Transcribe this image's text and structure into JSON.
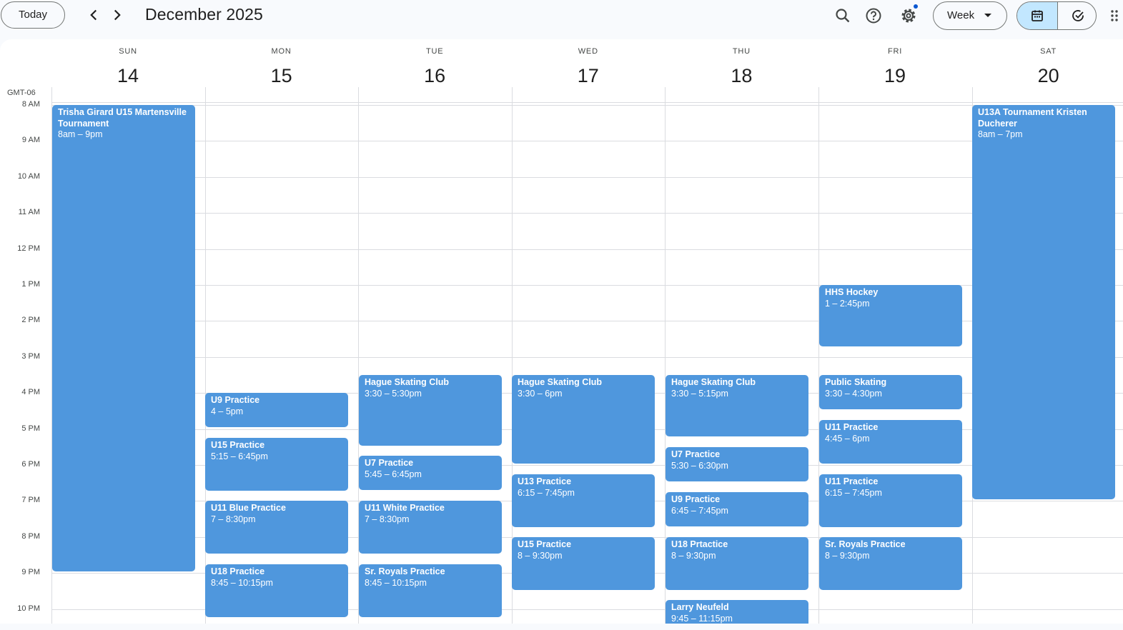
{
  "toolbar": {
    "today_label": "Today",
    "month_title": "December 2025",
    "view_label": "Week",
    "prev_icon": "chevron-left-icon",
    "next_icon": "chevron-right-icon",
    "search_icon": "search-icon",
    "help_icon": "help-icon",
    "settings_icon": "gear-icon",
    "calendar_view_icon": "calendar-icon",
    "tasks_view_icon": "task-check-icon",
    "apps_icon": "apps-grid-icon",
    "accent_color": "#c2e7ff"
  },
  "timezone": "GMT-06",
  "days": [
    {
      "name": "SUN",
      "num": "14"
    },
    {
      "name": "MON",
      "num": "15"
    },
    {
      "name": "TUE",
      "num": "16"
    },
    {
      "name": "WED",
      "num": "17"
    },
    {
      "name": "THU",
      "num": "18"
    },
    {
      "name": "FRI",
      "num": "19"
    },
    {
      "name": "SAT",
      "num": "20"
    }
  ],
  "hours": [
    "8 AM",
    "9 AM",
    "10 AM",
    "11 AM",
    "12 PM",
    "1 PM",
    "2 PM",
    "3 PM",
    "4 PM",
    "5 PM",
    "6 PM",
    "7 PM",
    "8 PM",
    "9 PM",
    "10 PM"
  ],
  "event_color": "#4f97dd",
  "events": [
    {
      "day": 0,
      "start": 8.0,
      "end": 21.0,
      "title": "Trisha Girard U15 Martensville Tournament",
      "time": "8am – 9pm"
    },
    {
      "day": 1,
      "start": 16.0,
      "end": 17.0,
      "title": "U9 Practice",
      "time": "4 – 5pm"
    },
    {
      "day": 1,
      "start": 17.25,
      "end": 18.75,
      "title": "U15 Practice",
      "time": "5:15 – 6:45pm"
    },
    {
      "day": 1,
      "start": 19.0,
      "end": 20.5,
      "title": "U11 Blue Practice",
      "time": "7 – 8:30pm"
    },
    {
      "day": 1,
      "start": 20.75,
      "end": 22.25,
      "title": "U18 Practice",
      "time": "8:45 – 10:15pm"
    },
    {
      "day": 2,
      "start": 15.5,
      "end": 17.5,
      "title": "Hague Skating Club",
      "time": "3:30 – 5:30pm"
    },
    {
      "day": 2,
      "start": 17.75,
      "end": 18.75,
      "title": "U7 Practice",
      "time": "5:45 – 6:45pm"
    },
    {
      "day": 2,
      "start": 19.0,
      "end": 20.5,
      "title": "U11 White Practice",
      "time": "7 – 8:30pm"
    },
    {
      "day": 2,
      "start": 20.75,
      "end": 22.25,
      "title": "Sr. Royals Practice",
      "time": "8:45 – 10:15pm"
    },
    {
      "day": 3,
      "start": 15.5,
      "end": 18.0,
      "title": "Hague Skating Club",
      "time": "3:30 – 6pm"
    },
    {
      "day": 3,
      "start": 18.25,
      "end": 19.75,
      "title": "U13 Practice",
      "time": "6:15 – 7:45pm"
    },
    {
      "day": 3,
      "start": 20.0,
      "end": 21.5,
      "title": "U15 Practice",
      "time": "8 – 9:30pm"
    },
    {
      "day": 4,
      "start": 15.5,
      "end": 17.25,
      "title": "Hague Skating Club",
      "time": "3:30 – 5:15pm"
    },
    {
      "day": 4,
      "start": 17.5,
      "end": 18.5,
      "title": "U7 Practice",
      "time": "5:30 – 6:30pm"
    },
    {
      "day": 4,
      "start": 18.75,
      "end": 19.75,
      "title": "U9 Practice",
      "time": "6:45 – 7:45pm"
    },
    {
      "day": 4,
      "start": 20.0,
      "end": 21.5,
      "title": "U18 Prtactice",
      "time": "8 – 9:30pm"
    },
    {
      "day": 4,
      "start": 21.75,
      "end": 23.25,
      "title": "Larry Neufeld",
      "time": "9:45 – 11:15pm"
    },
    {
      "day": 5,
      "start": 13.0,
      "end": 14.75,
      "title": "HHS Hockey",
      "time": "1 – 2:45pm"
    },
    {
      "day": 5,
      "start": 15.5,
      "end": 16.5,
      "title": "Public Skating",
      "time": "3:30 – 4:30pm"
    },
    {
      "day": 5,
      "start": 16.75,
      "end": 18.0,
      "title": "U11 Practice",
      "time": "4:45 – 6pm"
    },
    {
      "day": 5,
      "start": 18.25,
      "end": 19.75,
      "title": "U11 Practice",
      "time": "6:15 – 7:45pm"
    },
    {
      "day": 5,
      "start": 20.0,
      "end": 21.5,
      "title": "Sr. Royals Practice",
      "time": "8 – 9:30pm"
    },
    {
      "day": 6,
      "start": 8.0,
      "end": 19.0,
      "title": "U13A Tournament Kristen Ducherer",
      "time": "8am – 7pm"
    }
  ]
}
